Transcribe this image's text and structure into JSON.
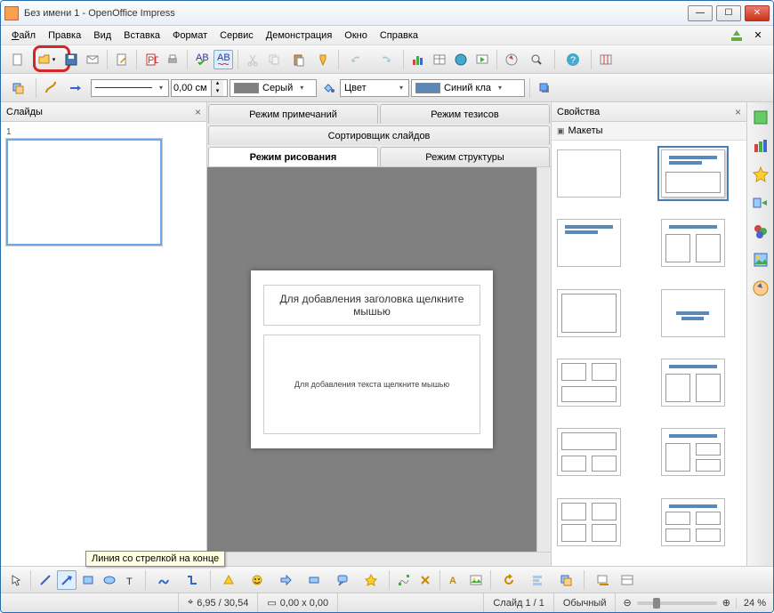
{
  "window": {
    "title": "Без имени 1 - OpenOffice Impress"
  },
  "menu": {
    "file": "Файл",
    "edit": "Правка",
    "view": "Вид",
    "insert": "Вставка",
    "format": "Формат",
    "tools": "Сервис",
    "slideshow": "Демонстрация",
    "window": "Окно",
    "help": "Справка"
  },
  "line_toolbar": {
    "width_value": "0,00 см",
    "color1_label": "Серый",
    "fill_type_label": "Цвет",
    "color2_label": "Синий кла"
  },
  "panels": {
    "slides_title": "Слайды",
    "props_title": "Свойства",
    "layouts_title": "Макеты"
  },
  "tabs": {
    "notes": "Режим примечаний",
    "handout": "Режим тезисов",
    "sorter": "Сортировщик слайдов",
    "drawing": "Режим рисования",
    "outline": "Режим структуры"
  },
  "slide": {
    "number": "1",
    "title_placeholder": "Для добавления заголовка щелкните мышью",
    "content_placeholder": "Для добавления текста щелкните мышью"
  },
  "tooltip": "Линия со стрелкой на конце",
  "status": {
    "cursor_pos": "6,95 / 30,54",
    "obj_size": "0,00 x 0,00",
    "slide_count": "Слайд 1 / 1",
    "mode": "Обычный",
    "zoom": "24 %"
  }
}
